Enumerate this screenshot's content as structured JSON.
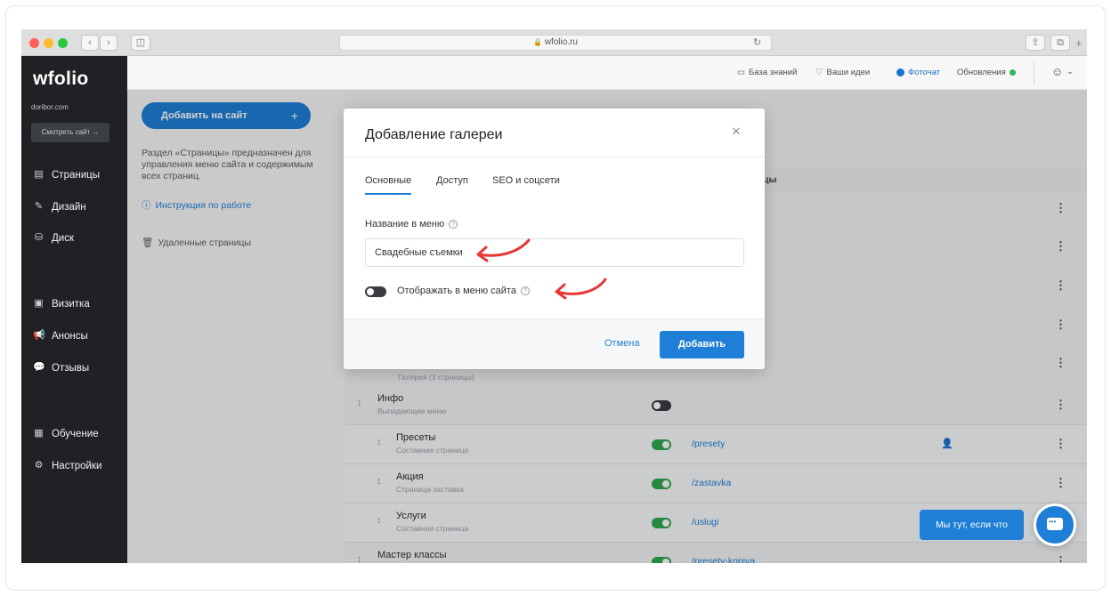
{
  "browser": {
    "url": "wfolio.ru",
    "lock_icon": "🔒",
    "colors": {
      "close": "#ff5f57",
      "min": "#febc2e",
      "max": "#28c840"
    }
  },
  "sidebar": {
    "logo": "wfolio",
    "domain": "doribor.com",
    "view_site": "Смотреть сайт →",
    "items": [
      {
        "label": "Страницы",
        "icon": "page-icon"
      },
      {
        "label": "Дизайн",
        "icon": "brush-icon"
      },
      {
        "label": "Диск",
        "icon": "disk-icon"
      },
      {
        "label": "Визитка",
        "icon": "card-icon"
      },
      {
        "label": "Анонсы",
        "icon": "megaphone-icon"
      },
      {
        "label": "Отзывы",
        "icon": "reviews-icon"
      },
      {
        "label": "Обучение",
        "icon": "book-icon"
      },
      {
        "label": "Настройки",
        "icon": "gear-icon"
      }
    ]
  },
  "topbar": {
    "knowledge": "База знаний",
    "ideas": "Ваши идеи",
    "fotochat": "Фоточат",
    "updates": "Обновления"
  },
  "panel": {
    "add_button": "Добавить на сайт",
    "add_plus": "+",
    "description": "Раздел «Страницы» предназначен для управления меню сайта и содержимым всех страниц.",
    "instructions": "Инструкция по работе",
    "deleted": "Удаленные страницы"
  },
  "table": {
    "header_fragment": "цы",
    "partial_row_sub": "Галерея (3 страницы)",
    "rows": [
      {
        "title": "Инфо",
        "sub": "Выпадающее меню",
        "toggle": false,
        "url": ""
      },
      {
        "title": "Пресеты",
        "sub": "Составная страница",
        "toggle": true,
        "url": "/presety"
      },
      {
        "title": "Акция",
        "sub": "Страница-заставка",
        "toggle": true,
        "url": "/zastavka"
      },
      {
        "title": "Услуги",
        "sub": "Составная страница",
        "toggle": true,
        "url": "/uslugi"
      },
      {
        "title": "Мастер классы",
        "sub": "",
        "toggle": true,
        "url": "/presety-kopiya"
      }
    ]
  },
  "modal": {
    "title": "Добавление галереи",
    "close": "×",
    "tabs": [
      "Основные",
      "Доступ",
      "SEO и соцсети"
    ],
    "name_label": "Название в меню",
    "name_value": "Свадебные съемки",
    "toggle_label": "Отображать в меню сайта",
    "cancel": "Отмена",
    "submit": "Добавить",
    "help_glyph": "?"
  },
  "chat": {
    "bubble": "Мы тут, если что"
  },
  "accent_color": "#1f7fd6",
  "arrow_color": "#e53935"
}
